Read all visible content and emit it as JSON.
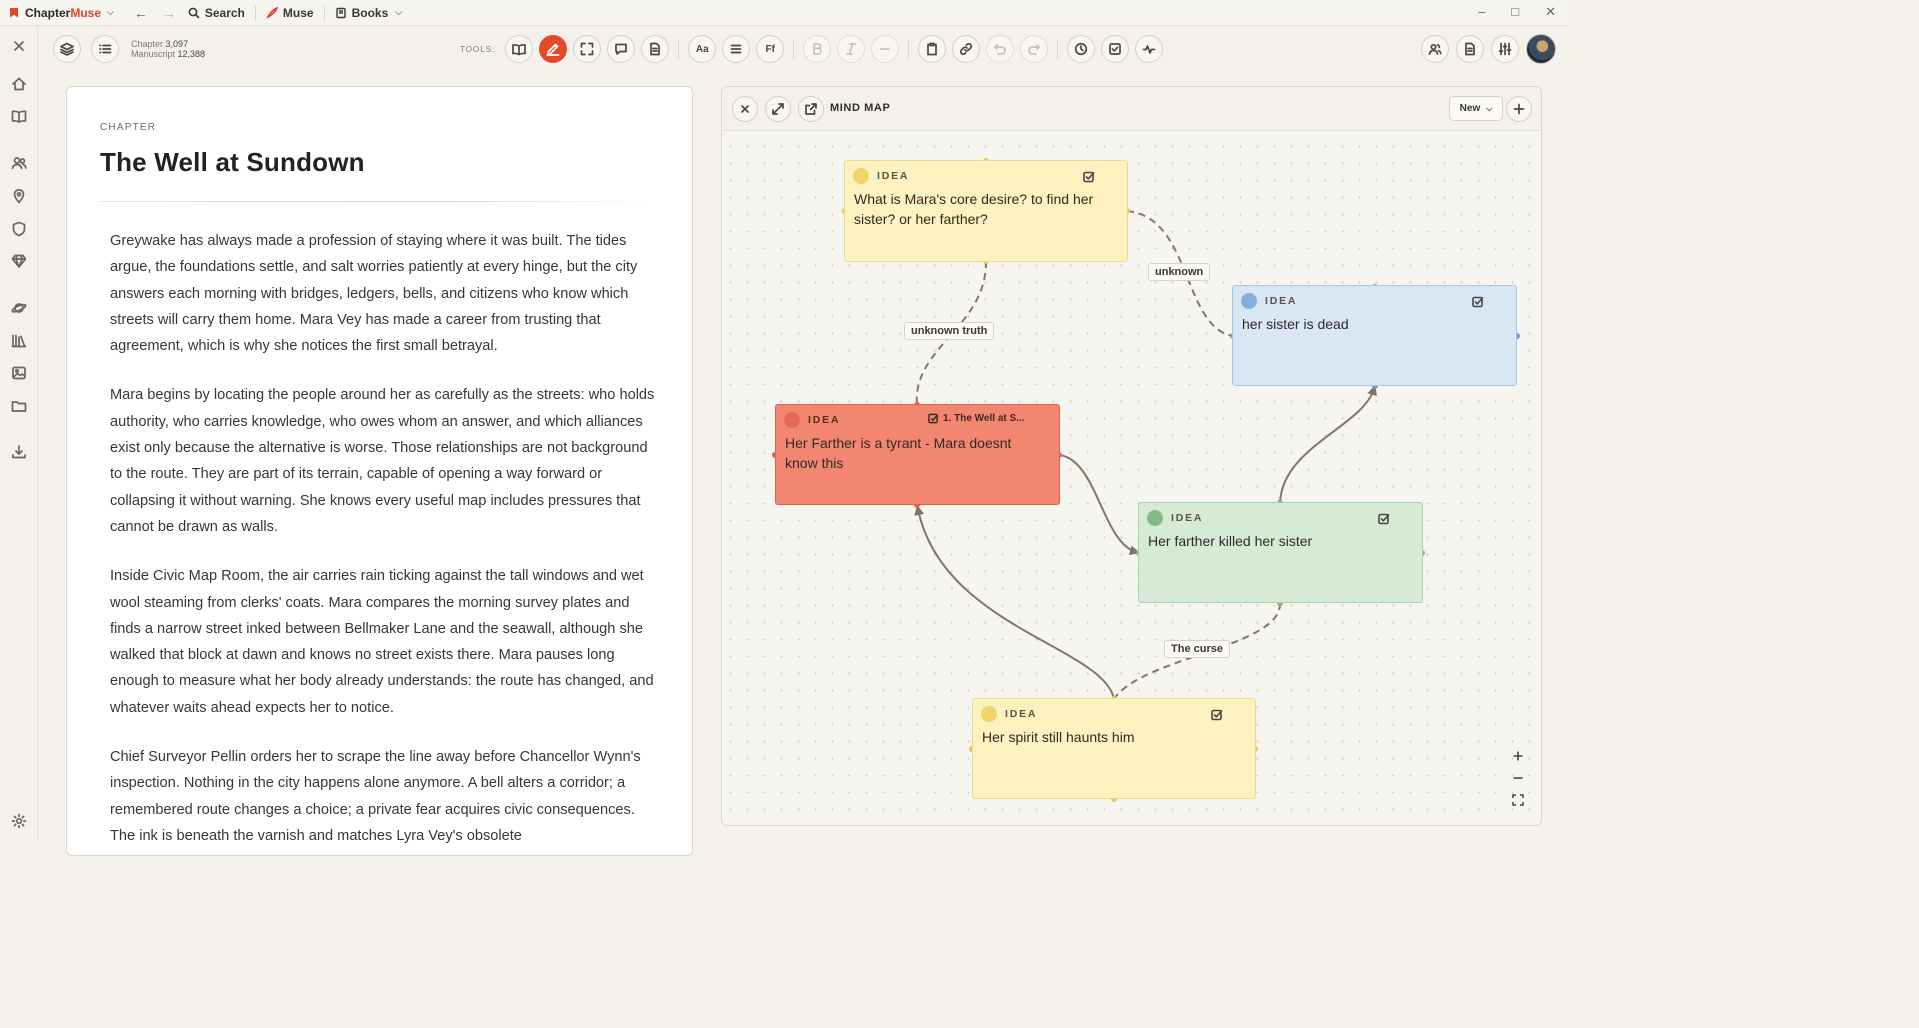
{
  "app": {
    "name_a": "Chapter",
    "name_b": "Muse"
  },
  "titlebar": {
    "search": "Search",
    "muse": "Muse",
    "books": "Books"
  },
  "counts": {
    "chapter_label": "Chapter",
    "chapter_value": "3,097",
    "manuscript_label": "Manuscript",
    "manuscript_value": "12,388"
  },
  "toolbar": {
    "tools_label": "TOOLS:",
    "font_size_btn": "Aa",
    "font_family_btn": "Ff"
  },
  "document": {
    "kicker": "CHAPTER",
    "title": "The Well at Sundown",
    "paragraphs": [
      "Greywake has always made a profession of staying where it was built. The tides argue, the foundations settle, and salt worries patiently at every hinge, but the city answers each morning with bridges, ledgers, bells, and citizens who know which streets will carry them home. Mara Vey has made a career from trusting that agreement, which is why she notices the first small betrayal.",
      "Mara begins by locating the people around her as carefully as the streets: who holds authority, who carries knowledge, who owes whom an answer, and which alliances exist only because the alternative is worse. Those relationships are not background to the route. They are part of its terrain, capable of opening a way forward or collapsing it without warning. She knows every useful map includes pressures that cannot be drawn as walls.",
      "Inside Civic Map Room, the air carries rain ticking against the tall windows and wet wool steaming from clerks' coats. Mara compares the morning survey plates and finds a narrow street inked between Bellmaker Lane and the seawall, although she walked that block at dawn and knows no street exists there. Mara pauses long enough to measure what her body already understands: the route has changed, and whatever waits ahead expects her to notice.",
      "Chief Surveyor Pellin orders her to scrape the line away before Chancellor Wynn's inspection. Nothing in the city happens alone anymore. A bell alters a corridor; a remembered route changes a choice; a private fear acquires civic consequences. The ink is beneath the varnish and matches Lyra Vey's obsolete"
    ]
  },
  "mindmap": {
    "title": "MIND MAP",
    "new_label": "New",
    "node_kind": "IDEA",
    "nodes": {
      "core": "What is Mara's core desire? to find her sister? or her farther?",
      "sister": "her sister is dead",
      "tyrant": "Her Farther is a tyrant - Mara doesnt know this",
      "tyrant_ref": "1. The Well at S...",
      "killed": "Her farther killed her sister",
      "spirit": "Her spirit still haunts him"
    },
    "edges": {
      "unknown": "unknown",
      "unknown_truth": "unknown truth",
      "curse": "The curse"
    }
  }
}
